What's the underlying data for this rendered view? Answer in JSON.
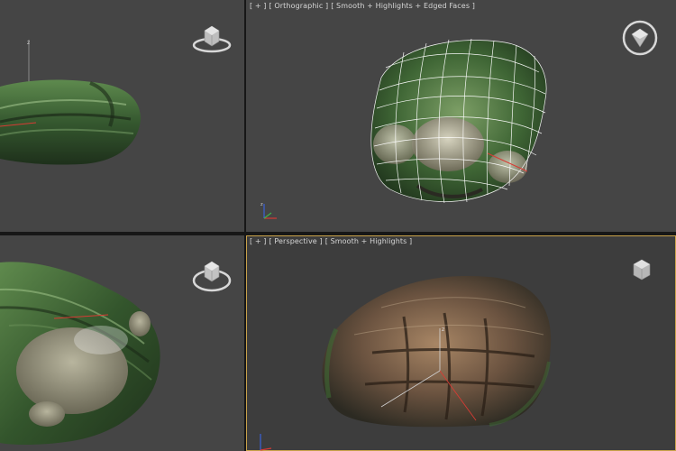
{
  "viewports": {
    "top_left": {
      "name": "left-view",
      "axis_label": "z"
    },
    "top_right": {
      "name": "orthographic-view",
      "label_parts": [
        "[ + ]",
        "[ Orthographic ]",
        "[ Smooth + Highlights + Edged Faces ]"
      ],
      "axis_label": "z"
    },
    "bottom_left": {
      "name": "front-view"
    },
    "bottom_right": {
      "name": "perspective-view",
      "label_parts": [
        "[ + ]",
        "[ Perspective ]",
        "[ Smooth + Highlights ]"
      ],
      "axis_label": "z",
      "active": true
    }
  },
  "colors": {
    "viewport_bg": "#454545",
    "active_viewport_border": "#c9a24a",
    "model_green": "#3e6a36",
    "model_stone": "#8d8a72",
    "model_brown": "#6e5640",
    "wire": "#ffffff",
    "axis_x": "#d73b34",
    "axis_y": "#3fb34a",
    "axis_z": "#3a62d8"
  },
  "icons": [
    "viewcube-icon",
    "axis-tripod-icon"
  ]
}
